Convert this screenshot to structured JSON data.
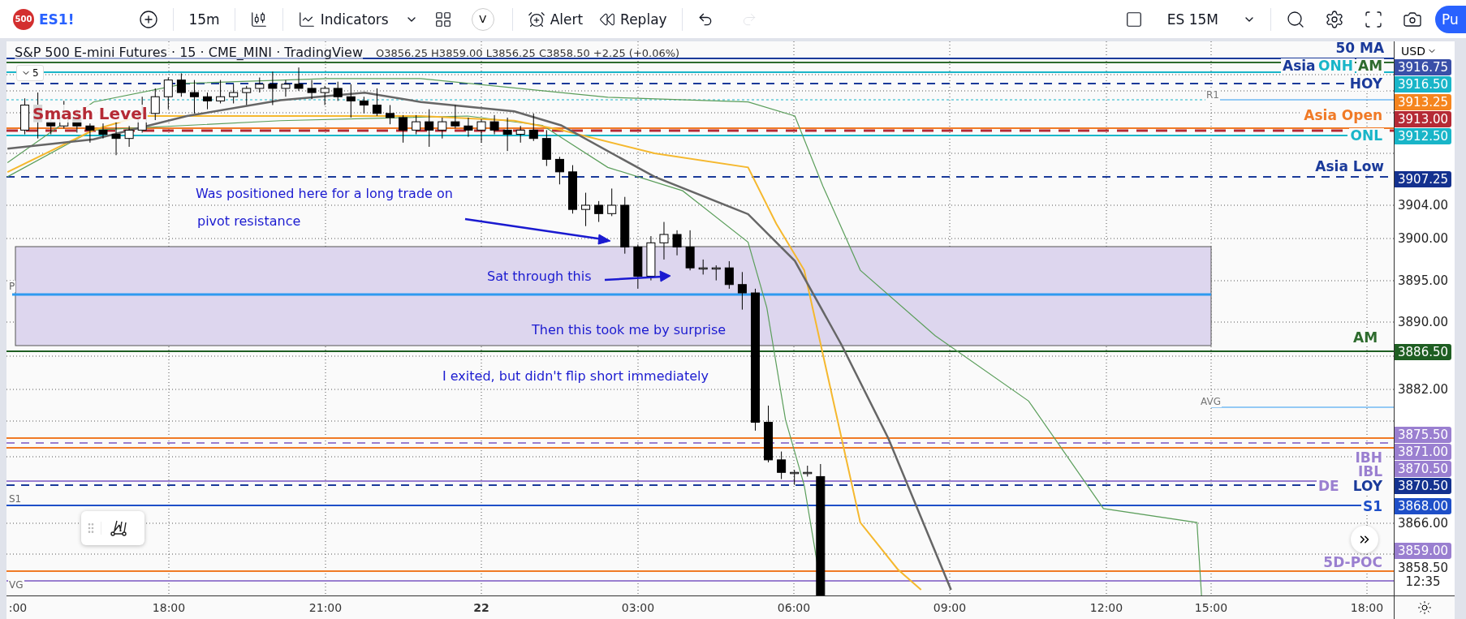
{
  "toolbar": {
    "symbol_badge": "500",
    "symbol": "ES1!",
    "interval": "15m",
    "indicators": "Indicators",
    "v_badge": "V",
    "alert": "Alert",
    "replay": "Replay",
    "history": [
      {
        "kind": "undo",
        "disabled": false
      },
      {
        "kind": "redo",
        "disabled": true
      }
    ],
    "layout_name": "ES 15M",
    "publish": "Pu"
  },
  "legend": {
    "title": "S&P 500 E-mini Futures · 15 · CME_MINI · TradingView",
    "ohlc": "O3856.25 H3859.00 L3856.25 C3858.50 +2.25 (+0.06%)",
    "collapse_count": "5"
  },
  "smash_level": "Smash Level",
  "level_labels": [
    {
      "text": "50 MA",
      "color": "#1a3a9a"
    },
    {
      "text": "Asia",
      "color": "#1a3a9a"
    },
    {
      "text": "ONH",
      "color": "#19b5c8"
    },
    {
      "text": "AM",
      "color": "#2e6b2e"
    },
    {
      "text": "HOY",
      "color": "#1a3a9a"
    },
    {
      "text": "R1",
      "color": "#777777"
    },
    {
      "text": "Asia Open",
      "color": "#f07a26"
    },
    {
      "text": "ONL",
      "color": "#19b5c8"
    },
    {
      "text": "Asia Low",
      "color": "#1a3a9a"
    },
    {
      "text": "AM",
      "color": "#2e6b2e"
    },
    {
      "text": "AVG",
      "color": "#777777"
    },
    {
      "text": "IBH",
      "color": "#9a7fd0"
    },
    {
      "text": "IBL",
      "color": "#9a7fd0"
    },
    {
      "text": "DE",
      "color": "#9a7fd0"
    },
    {
      "text": "LOY",
      "color": "#1a3a9a"
    },
    {
      "text": "S1",
      "color": "#1e4fc8"
    },
    {
      "text": "5D-POC",
      "color": "#9a7fd0"
    }
  ],
  "left_labels": [
    "P",
    "S1",
    "VG"
  ],
  "annotations": [
    "Was positioned here for a long trade on",
    "pivot resistance",
    "Sat through this",
    "Then this took me by surprise",
    "I exited, but didn't flip short immediately"
  ],
  "price_axis": {
    "currency": "USD",
    "labels": [
      {
        "text": "3916.75",
        "kind": "badge",
        "color": "#3a4fa8"
      },
      {
        "text": "3916.50",
        "kind": "badge",
        "color": "#19b5c8"
      },
      {
        "text": "3913.25",
        "kind": "badge",
        "color": "#f5851f"
      },
      {
        "text": "3913.00",
        "kind": "badge",
        "color": "#b52a35"
      },
      {
        "text": "3912.50",
        "kind": "badge",
        "color": "#19b5c8"
      },
      {
        "text": "3907.25",
        "kind": "badge",
        "color": "#13318f"
      },
      {
        "text": "3904.00",
        "kind": "tick"
      },
      {
        "text": "3900.00",
        "kind": "tick"
      },
      {
        "text": "3895.00",
        "kind": "tick"
      },
      {
        "text": "3890.00",
        "kind": "tick"
      },
      {
        "text": "3886.50",
        "kind": "badge",
        "color": "#1e5e22"
      },
      {
        "text": "3882.00",
        "kind": "tick"
      },
      {
        "text": "3875.50",
        "kind": "badge",
        "color": "#9a7fd0"
      },
      {
        "text": "3871.00",
        "kind": "badge",
        "color": "#9a7fd0"
      },
      {
        "text": "3870.50",
        "kind": "badge",
        "color": "#9a7fd0"
      },
      {
        "text": "3870.50",
        "kind": "badge",
        "color": "#13318f"
      },
      {
        "text": "3868.00",
        "kind": "badge",
        "color": "#1e4fc8"
      },
      {
        "text": "3866.00",
        "kind": "tick"
      },
      {
        "text": "3859.00",
        "kind": "badge",
        "color": "#9a7fd0"
      },
      {
        "text": "3858.50",
        "kind": "tick"
      },
      {
        "text": "12:35",
        "kind": "tick"
      }
    ]
  },
  "time_axis": [
    {
      "text": ":00",
      "bold": false
    },
    {
      "text": "18:00",
      "bold": false
    },
    {
      "text": "21:00",
      "bold": false
    },
    {
      "text": "22",
      "bold": true
    },
    {
      "text": "03:00",
      "bold": false
    },
    {
      "text": "06:00",
      "bold": false
    },
    {
      "text": "09:00",
      "bold": false
    },
    {
      "text": "12:00",
      "bold": false
    },
    {
      "text": "15:00",
      "bold": false
    },
    {
      "text": "18:00",
      "bold": false
    }
  ]
}
